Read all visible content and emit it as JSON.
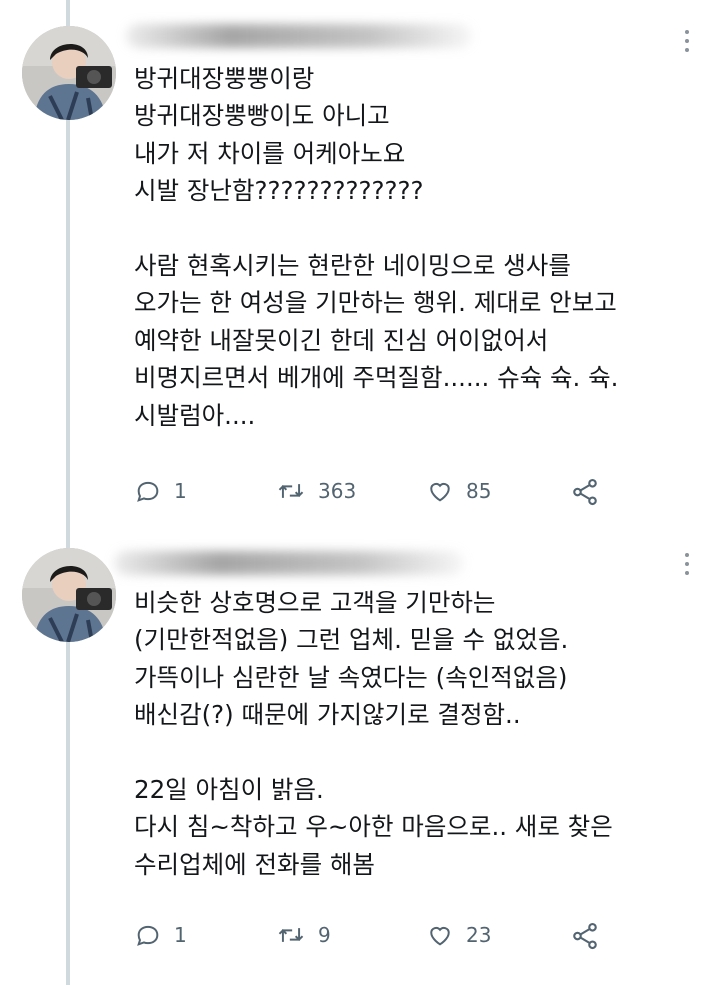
{
  "tweets": [
    {
      "display_name": "",
      "body": "방귀대장뿡뿡이랑\n방귀대장뿡빵이도 아니고\n내가 저 차이를 어케아노요\n시발 장난함?????????????\n\n사람 현혹시키는 현란한 네이밍으로 생사를\n오가는 한 여성을 기만하는 행위. 제대로 안보고\n예약한 내잘못이긴 한데 진심 어이없어서\n비명지르면서 베개에 주먹질함...... 슈슉 슉. 슉.\n시발럼아....",
      "replies": "1",
      "retweets": "363",
      "likes": "85"
    },
    {
      "display_name": "",
      "body": "비슷한 상호명으로 고객을 기만하는\n(기만한적없음) 그런 업체. 믿을 수 없었음.\n가뜩이나 심란한 날 속였다는 (속인적없음)\n배신감(?) 때문에 가지않기로 결정함..\n\n22일 아침이 밝음.\n다시 침~착하고 우~아한 마음으로.. 새로 찾은\n수리업체에 전화를 해봄",
      "replies": "1",
      "retweets": "9",
      "likes": "23"
    }
  ],
  "icons": {
    "reply": "reply-icon",
    "retweet": "retweet-icon",
    "like": "heart-icon",
    "share": "share-icon",
    "more": "more-options-icon"
  },
  "colors": {
    "icon": "#536471",
    "thread_line": "#cfd9de",
    "text": "#14171a"
  }
}
